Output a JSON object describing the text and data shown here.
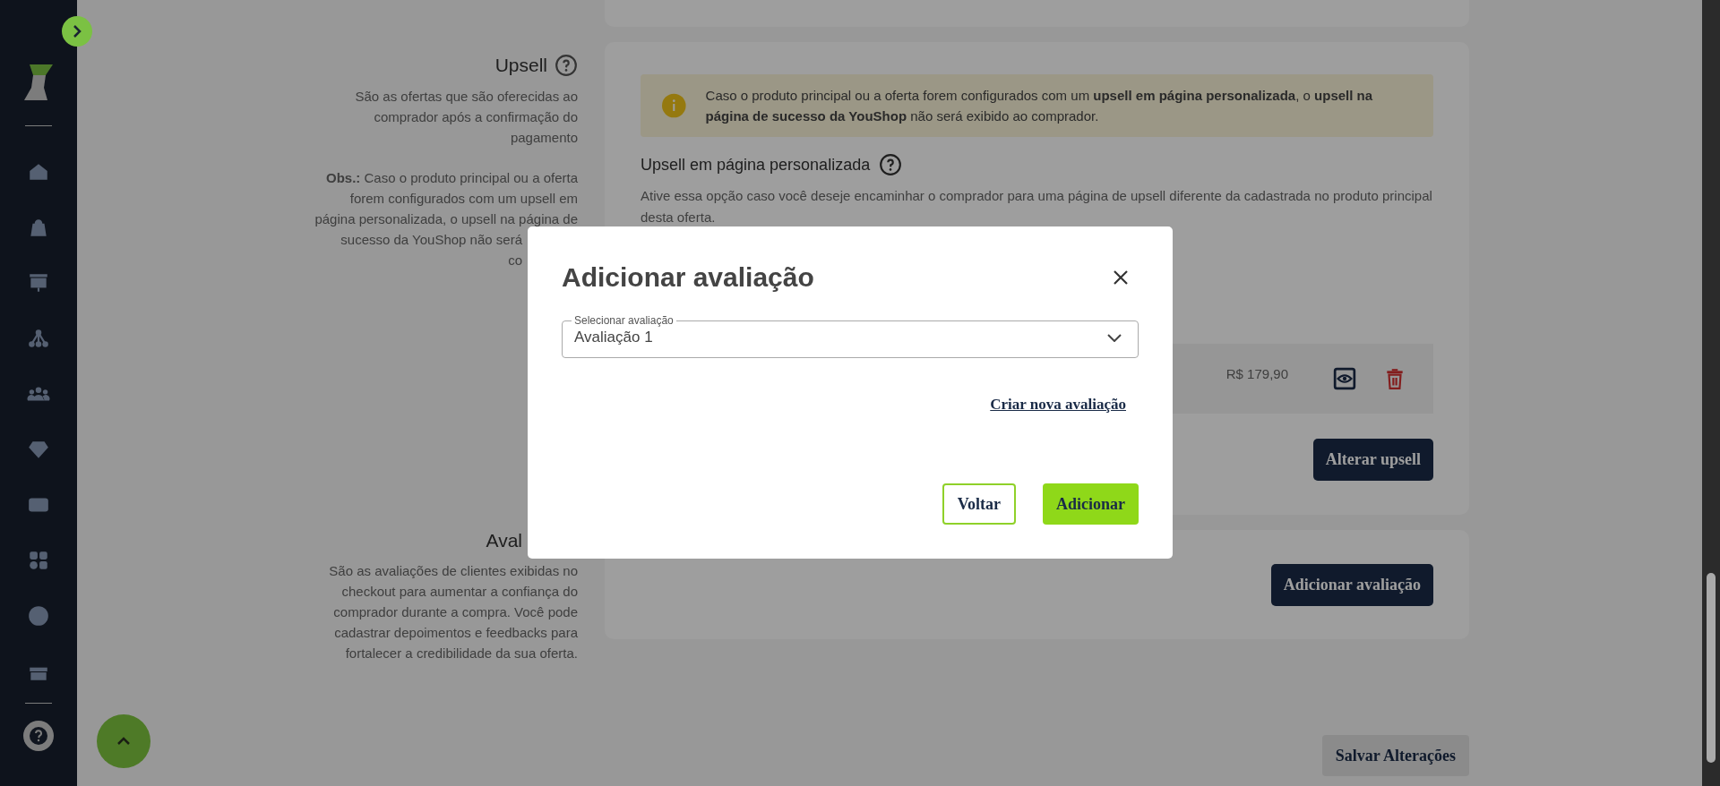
{
  "upsell_section": {
    "title": "Upsell",
    "description": "São as ofertas que são oferecidas ao comprador após a confirmação do pagamento",
    "note_lines": [
      {
        "text": "**Obs.:** Caso o produto principal ou a oferta",
        "cut": false
      },
      {
        "text": "forem configurados com um upsell em",
        "cut": false
      },
      {
        "text": "página personalizada, o upsell na página de",
        "cut": false
      },
      {
        "text": "sucesso da YouShop não será",
        "cut": true
      },
      {
        "text": "co",
        "cut": true
      }
    ],
    "warning": "Caso o produto principal ou a oferta forem configurados com um **upsell em página personalizada**, o **upsell na página de sucesso da YouShop** não será exibido ao comprador.",
    "custom_page_title": "Upsell em página personalizada",
    "custom_page_description": "Ative essa opção caso você deseje encaminhar o comprador para uma página de upsell diferente da cadastrada no produto principal desta oferta.",
    "product_price": "R$ 179,90",
    "change_button": "Alterar upsell"
  },
  "reviews_section": {
    "title": "Aval",
    "description": "São as avaliações de clientes exibidas no checkout para aumentar a confiança do comprador durante a compra. Você pode cadastrar depoimentos e feedbacks para fortalecer a credibilidade da sua oferta.",
    "add_button": "Adicionar avaliação"
  },
  "save_button": {
    "label": "Salvar Alterações",
    "disabled": true
  },
  "modal": {
    "title": "Adicionar avaliação",
    "select": {
      "label": "Selecionar avaliação",
      "value": "Avaliação 1"
    },
    "create_link": "Criar nova avaliação",
    "buttons": [
      {
        "label": "Voltar",
        "kind": "secondary"
      },
      {
        "label": "Adicionar",
        "kind": "primary"
      }
    ]
  }
}
